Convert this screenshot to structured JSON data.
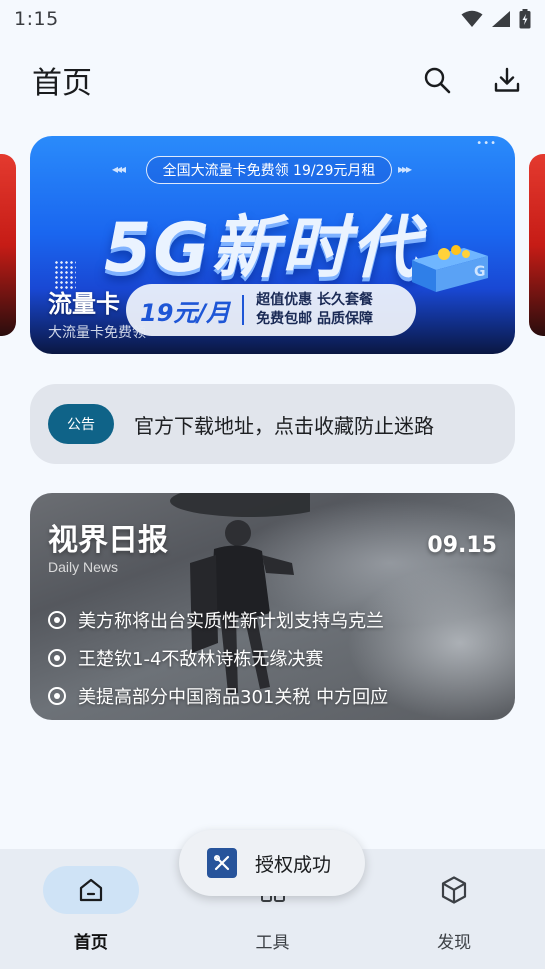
{
  "status_bar": {
    "time": "1:15"
  },
  "app_bar": {
    "title": "首页"
  },
  "banner": {
    "pill_text": "全国大流量卡免费领 19/29元月租",
    "headline": "5G新时代",
    "price": "19元/月",
    "offer_line1": "超值优惠 长久套餐",
    "offer_line2": "免费包邮 品质保障",
    "title": "流量卡",
    "subtitle": "大流量卡免费领"
  },
  "notice": {
    "badge": "公告",
    "text": "官方下载地址，点击收藏防止迷路"
  },
  "daily_news": {
    "title": "视界日报",
    "subtitle": "Daily News",
    "date": "09.15",
    "items": [
      "美方称将出台实质性新计划支持乌克兰",
      "王楚钦1-4不敌林诗栋无缘决赛",
      "美提高部分中国商品301关税 中方回应"
    ]
  },
  "bottom_nav": {
    "items": [
      {
        "label": "首页",
        "icon": "home-icon",
        "active": true
      },
      {
        "label": "工具",
        "icon": "tools-icon",
        "active": false
      },
      {
        "label": "发现",
        "icon": "cube-icon",
        "active": false
      }
    ]
  },
  "toast": {
    "text": "授权成功",
    "icon": "tools-icon"
  },
  "colors": {
    "background": "#f5f9fe",
    "notice_badge": "#0f6388",
    "nav_active_pill": "#cfe3f6",
    "toast_icon": "#27549b"
  }
}
